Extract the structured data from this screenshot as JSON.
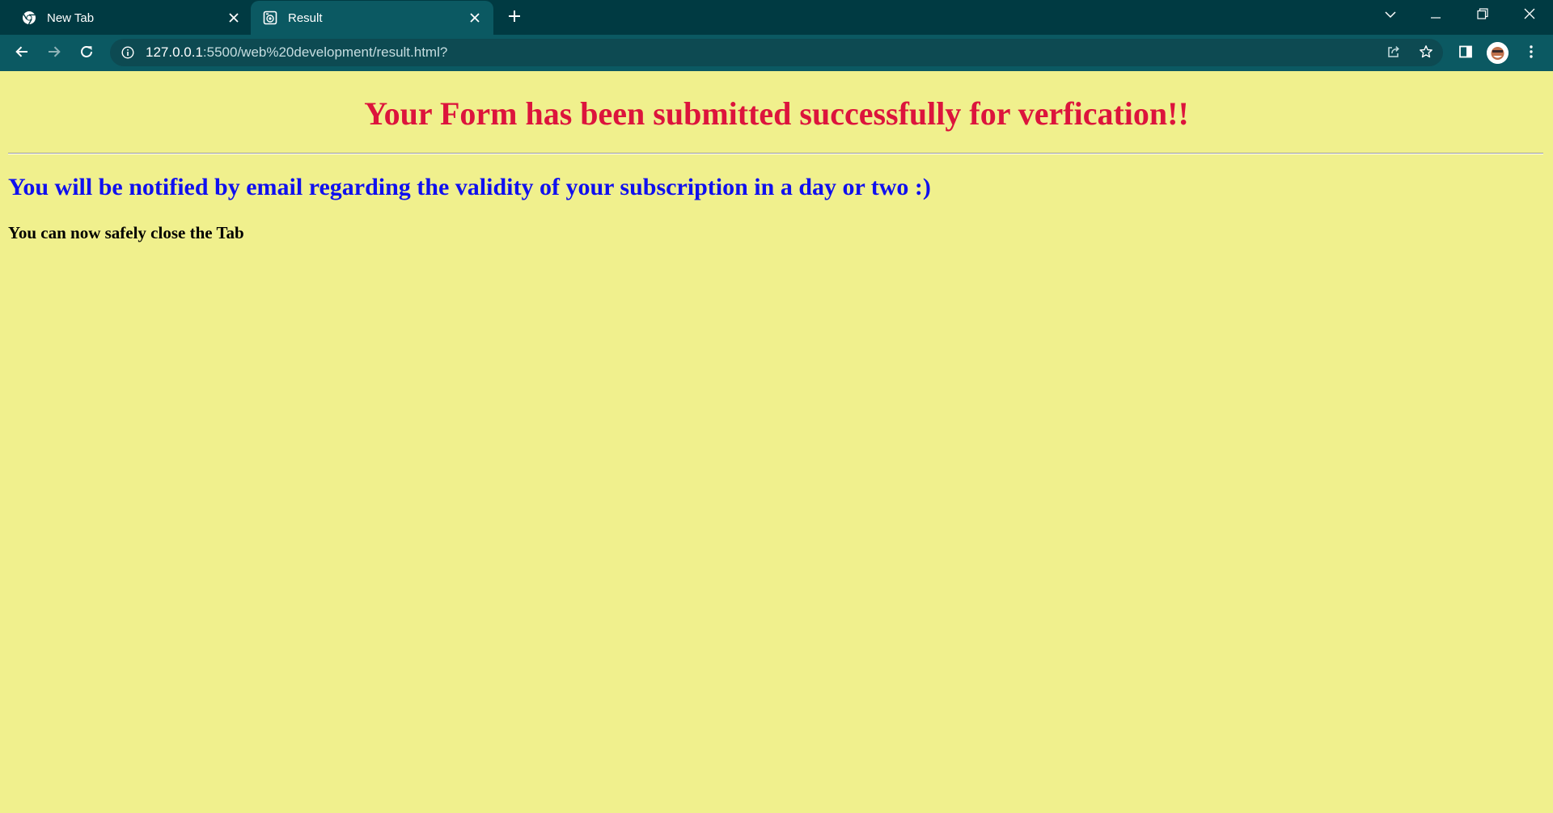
{
  "browser": {
    "tabs": [
      {
        "title": "New Tab",
        "icon": "chrome-icon",
        "active": false
      },
      {
        "title": "Result",
        "icon": "page-favicon-icon",
        "active": true
      }
    ],
    "address_bar": {
      "host": "127.0.0.1",
      "path": ":5500/web%20development/result.html?"
    },
    "colors": {
      "tabstrip": "#003a42",
      "toolbar": "#0b5962",
      "omnibox": "#0d4a52"
    }
  },
  "page": {
    "background": "#f0f08d",
    "title": "Your Form has been submitted successfully for verfication!!",
    "subtitle": "You will be notified by email regarding the validity of your subscription in a day or two :)",
    "note": "You can now safely close the Tab",
    "colors": {
      "title": "#dc143c",
      "subtitle": "#1010ee",
      "note": "#000000"
    }
  }
}
